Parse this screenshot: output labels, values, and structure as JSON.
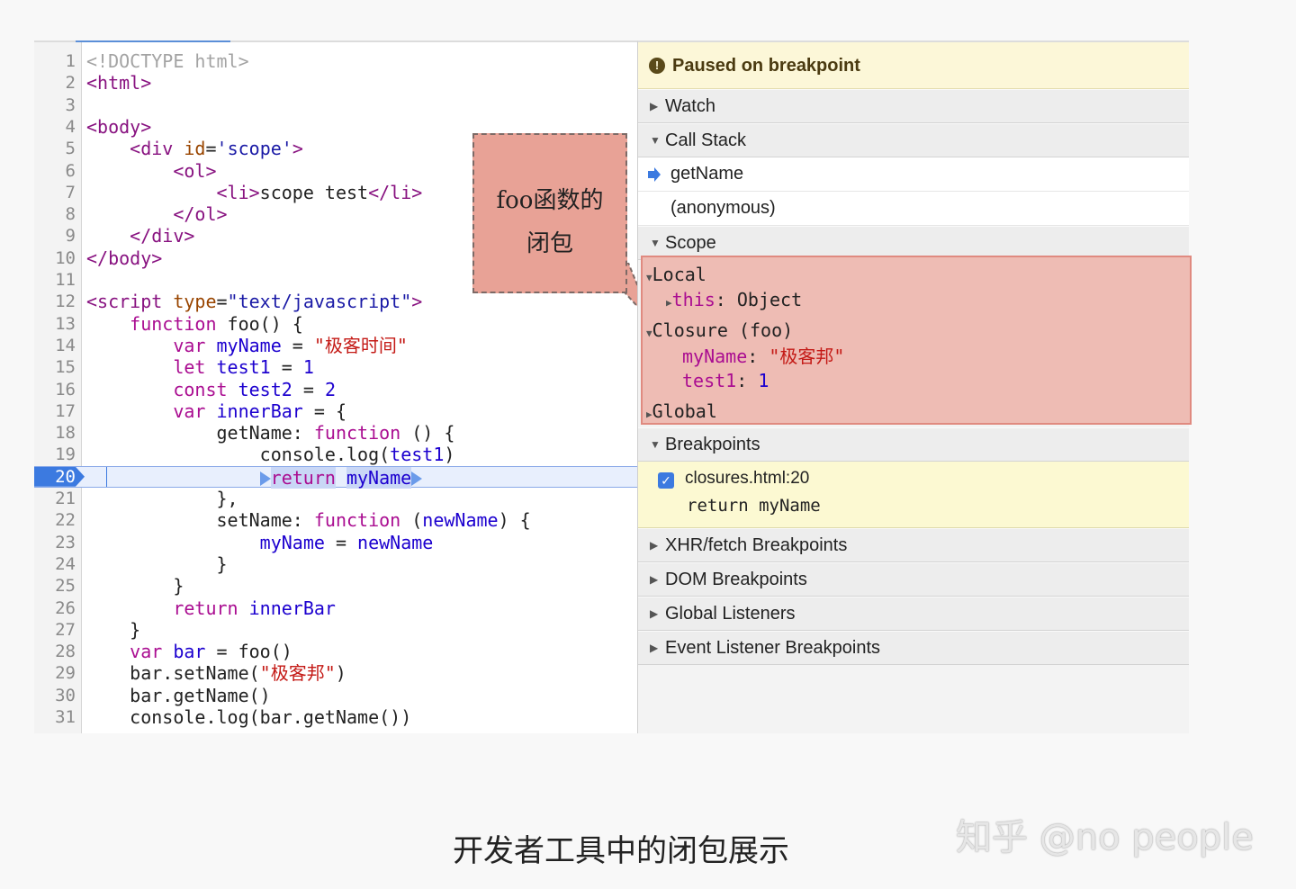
{
  "editor": {
    "lines": [
      {
        "n": "1",
        "parts": [
          [
            "c-dim",
            "<!DOCTYPE html>"
          ]
        ]
      },
      {
        "n": "2",
        "parts": [
          [
            "c-tag",
            "<html>"
          ]
        ]
      },
      {
        "n": "3",
        "parts": []
      },
      {
        "n": "4",
        "parts": [
          [
            "c-tag",
            "<body>"
          ]
        ]
      },
      {
        "n": "5",
        "parts": [
          [
            "",
            "    "
          ],
          [
            "c-tag",
            "<div "
          ],
          [
            "c-attr",
            "id"
          ],
          [
            "",
            "="
          ],
          [
            "c-str",
            "'scope'"
          ],
          [
            "c-tag",
            ">"
          ]
        ]
      },
      {
        "n": "6",
        "parts": [
          [
            "",
            "        "
          ],
          [
            "c-tag",
            "<ol>"
          ]
        ]
      },
      {
        "n": "7",
        "parts": [
          [
            "",
            "            "
          ],
          [
            "c-tag",
            "<li>"
          ],
          [
            "",
            "scope test"
          ],
          [
            "c-tag",
            "</li>"
          ]
        ]
      },
      {
        "n": "8",
        "parts": [
          [
            "",
            "        "
          ],
          [
            "c-tag",
            "</ol>"
          ]
        ]
      },
      {
        "n": "9",
        "parts": [
          [
            "",
            "    "
          ],
          [
            "c-tag",
            "</div>"
          ]
        ]
      },
      {
        "n": "10",
        "parts": [
          [
            "c-tag",
            "</body>"
          ]
        ]
      },
      {
        "n": "11",
        "parts": []
      },
      {
        "n": "12",
        "parts": [
          [
            "c-tag",
            "<script "
          ],
          [
            "c-attr",
            "type"
          ],
          [
            "",
            "="
          ],
          [
            "c-str",
            "\"text/javascript\""
          ],
          [
            "c-tag",
            ">"
          ]
        ]
      },
      {
        "n": "13",
        "parts": [
          [
            "",
            "    "
          ],
          [
            "c-kw",
            "function"
          ],
          [
            "",
            " foo() {"
          ]
        ]
      },
      {
        "n": "14",
        "parts": [
          [
            "",
            "        "
          ],
          [
            "c-kw",
            "var"
          ],
          [
            "",
            " "
          ],
          [
            "c-var",
            "myName"
          ],
          [
            "",
            " = "
          ],
          [
            "c-red",
            "\"极客时间\""
          ]
        ]
      },
      {
        "n": "15",
        "parts": [
          [
            "",
            "        "
          ],
          [
            "c-kw",
            "let"
          ],
          [
            "",
            " "
          ],
          [
            "c-var",
            "test1"
          ],
          [
            "",
            " = "
          ],
          [
            "c-var",
            "1"
          ]
        ]
      },
      {
        "n": "16",
        "parts": [
          [
            "",
            "        "
          ],
          [
            "c-kw",
            "const"
          ],
          [
            "",
            " "
          ],
          [
            "c-var",
            "test2"
          ],
          [
            "",
            " = "
          ],
          [
            "c-var",
            "2"
          ]
        ]
      },
      {
        "n": "17",
        "parts": [
          [
            "",
            "        "
          ],
          [
            "c-kw",
            "var"
          ],
          [
            "",
            " "
          ],
          [
            "c-var",
            "innerBar"
          ],
          [
            "",
            " = {"
          ]
        ]
      },
      {
        "n": "18",
        "parts": [
          [
            "",
            "            getName: "
          ],
          [
            "c-kw",
            "function"
          ],
          [
            "",
            " () {"
          ]
        ]
      },
      {
        "n": "19",
        "parts": [
          [
            "",
            "                console.log("
          ],
          [
            "c-var",
            "test1"
          ],
          [
            "",
            ")"
          ]
        ]
      },
      {
        "n": "20",
        "active": true,
        "parts": [
          [
            "",
            "                "
          ],
          [
            "bp-mark",
            ""
          ],
          [
            "bp-ret",
            "return"
          ],
          [
            "",
            " "
          ],
          [
            "bp-name",
            "myName"
          ],
          [
            "bp-mark",
            ""
          ]
        ]
      },
      {
        "n": "21",
        "parts": [
          [
            "",
            "            },"
          ]
        ]
      },
      {
        "n": "22",
        "parts": [
          [
            "",
            "            setName: "
          ],
          [
            "c-kw",
            "function"
          ],
          [
            "",
            " ("
          ],
          [
            "c-var",
            "newName"
          ],
          [
            "",
            ") {"
          ]
        ]
      },
      {
        "n": "23",
        "parts": [
          [
            "",
            "                "
          ],
          [
            "c-var",
            "myName"
          ],
          [
            "",
            " = "
          ],
          [
            "c-var",
            "newName"
          ]
        ]
      },
      {
        "n": "24",
        "parts": [
          [
            "",
            "            }"
          ]
        ]
      },
      {
        "n": "25",
        "parts": [
          [
            "",
            "        }"
          ]
        ]
      },
      {
        "n": "26",
        "parts": [
          [
            "",
            "        "
          ],
          [
            "c-kw",
            "return"
          ],
          [
            "",
            " "
          ],
          [
            "c-var",
            "innerBar"
          ]
        ]
      },
      {
        "n": "27",
        "parts": [
          [
            "",
            "    }"
          ]
        ]
      },
      {
        "n": "28",
        "parts": [
          [
            "",
            "    "
          ],
          [
            "c-kw",
            "var"
          ],
          [
            "",
            " "
          ],
          [
            "c-var",
            "bar"
          ],
          [
            "",
            " = foo()"
          ]
        ]
      },
      {
        "n": "29",
        "parts": [
          [
            "",
            "    bar.setName("
          ],
          [
            "c-red",
            "\"极客邦\""
          ],
          [
            "",
            ")"
          ]
        ]
      },
      {
        "n": "30",
        "parts": [
          [
            "",
            "    bar.getName()"
          ]
        ]
      },
      {
        "n": "31",
        "parts": [
          [
            "",
            "    console.log(bar.getName())"
          ]
        ]
      }
    ]
  },
  "callout": {
    "line1": "foo函数的",
    "line2": "闭包"
  },
  "debugger": {
    "paused_icon": "!",
    "paused": "Paused on breakpoint",
    "watch": "Watch",
    "call_stack": "Call Stack",
    "frames": [
      "getName",
      "(anonymous)"
    ],
    "scope": "Scope",
    "local": "Local",
    "this_key": "this",
    "this_val": "Object",
    "closure": "Closure (foo)",
    "myname_key": "myName",
    "myname_val": "\"极客邦\"",
    "test1_key": "test1",
    "test1_val": "1",
    "global": "Global",
    "breakpoints": "Breakpoints",
    "bp_file": "closures.html:20",
    "bp_code": "return myName",
    "xhr": "XHR/fetch Breakpoints",
    "dom": "DOM Breakpoints",
    "global_listeners": "Global Listeners",
    "event_listener": "Event Listener Breakpoints"
  },
  "caption": "开发者工具中的闭包展示",
  "watermark": "知乎 @no people"
}
